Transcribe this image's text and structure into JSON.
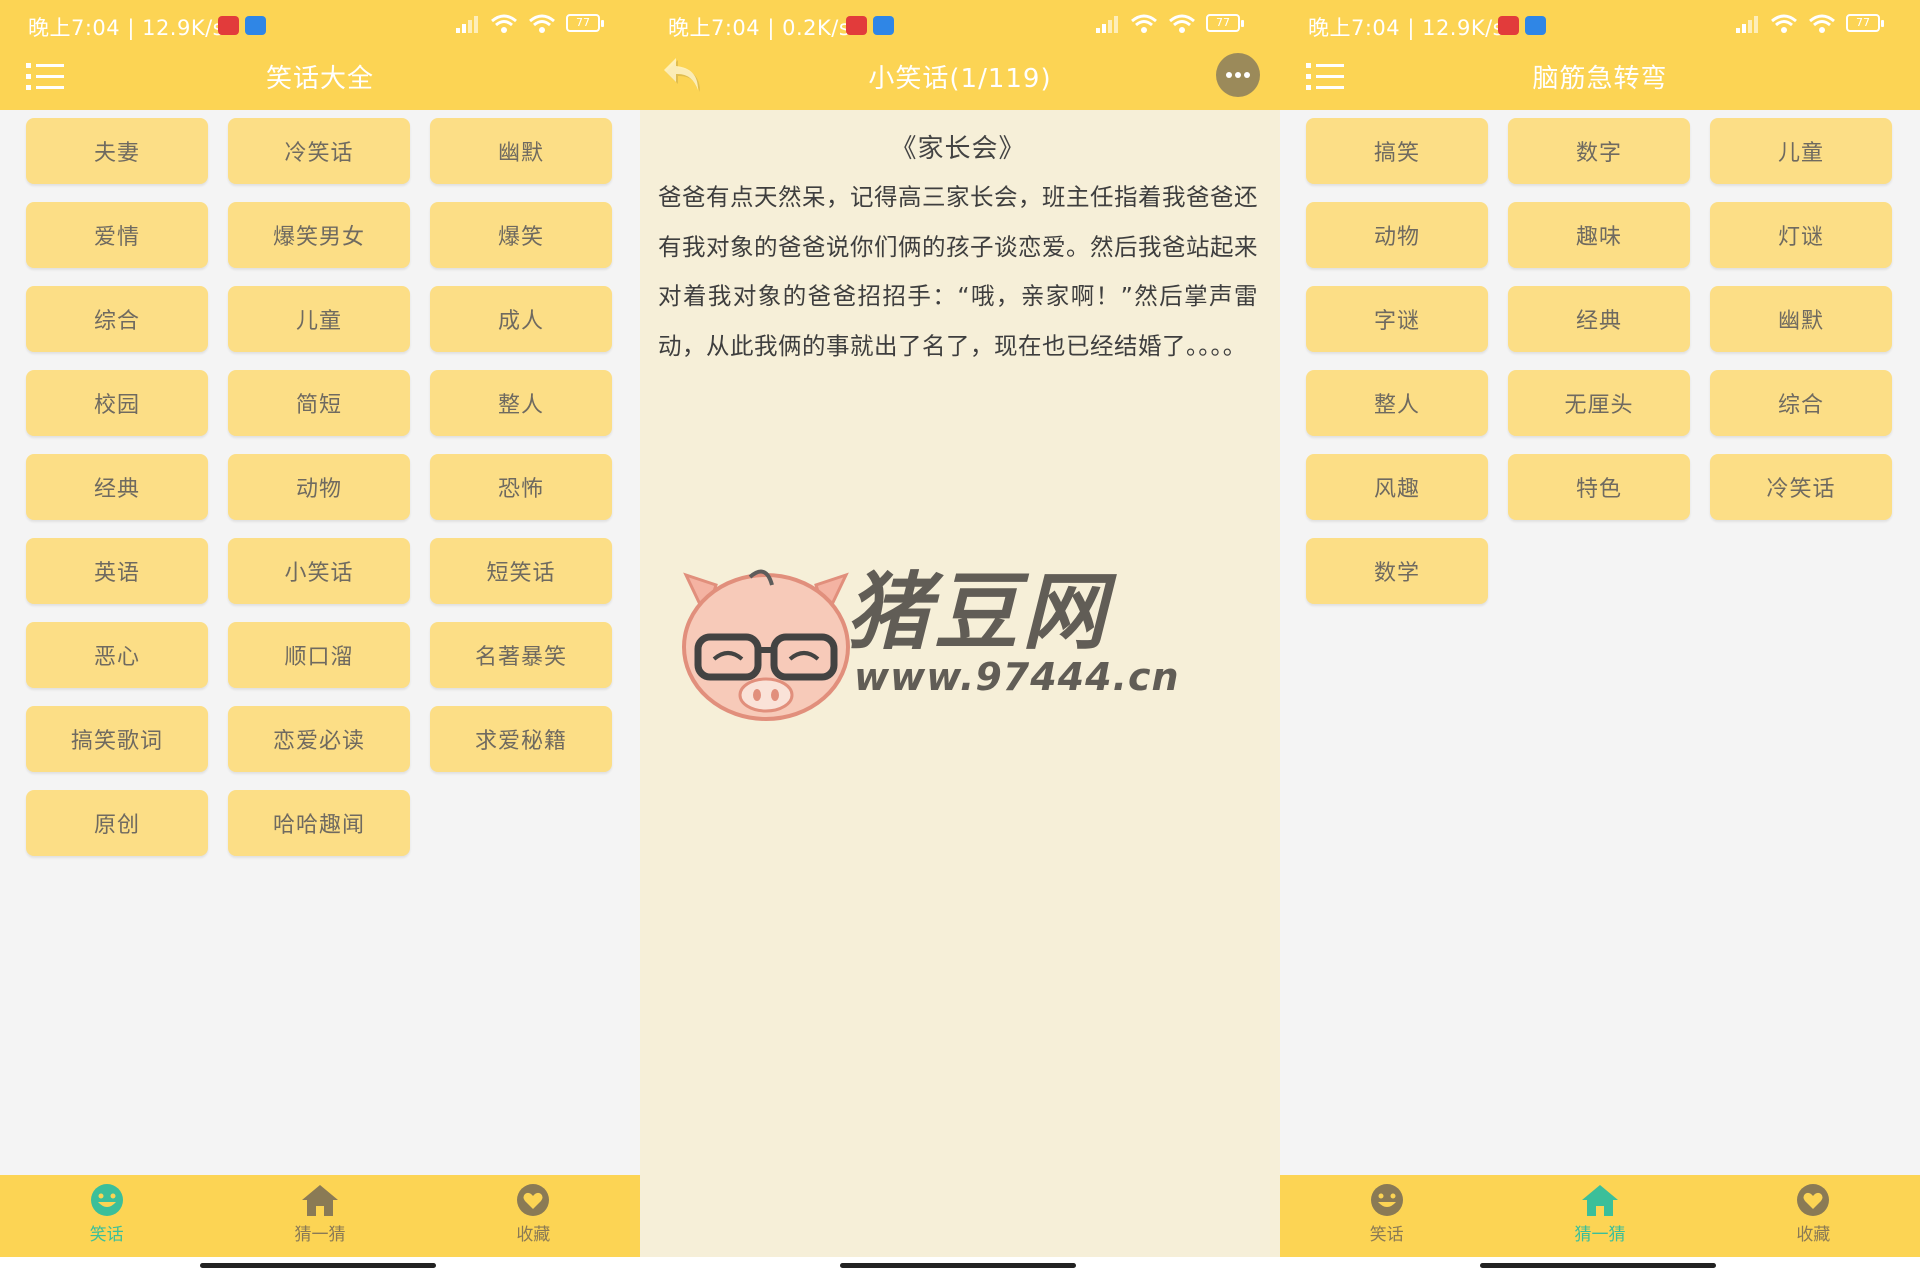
{
  "status": {
    "panel1": "晚上7:04 | 12.9K/s",
    "panel2": "晚上7:04 | 0.2K/s",
    "panel3": "晚上7:04 | 12.9K/s",
    "battery": "77"
  },
  "panel1": {
    "title": "笑话大全",
    "categories": [
      "夫妻",
      "冷笑话",
      "幽默",
      "爱情",
      "爆笑男女",
      "爆笑",
      "综合",
      "儿童",
      "成人",
      "校园",
      "简短",
      "整人",
      "经典",
      "动物",
      "恐怖",
      "英语",
      "小笑话",
      "短笑话",
      "恶心",
      "顺口溜",
      "名著暴笑",
      "搞笑歌词",
      "恋爱必读",
      "求爱秘籍",
      "原创",
      "哈哈趣闻"
    ]
  },
  "panel2": {
    "title": "小笑话(1/119)",
    "joke_title": "《家长会》",
    "joke_body": "爸爸有点天然呆，记得高三家长会，班主任指着我爸爸还有我对象的爸爸说你们俩的孩子谈恋爱。然后我爸站起来对着我对象的爸爸招招手：“哦，亲家啊！”然后掌声雷动，从此我俩的事就出了名了，现在也已经结婚了。。。。",
    "watermark_text": "猪豆网",
    "watermark_url": "www.97444.cn"
  },
  "panel3": {
    "title": "脑筋急转弯",
    "categories": [
      "搞笑",
      "数字",
      "儿童",
      "动物",
      "趣味",
      "灯谜",
      "字谜",
      "经典",
      "幽默",
      "整人",
      "无厘头",
      "综合",
      "风趣",
      "特色",
      "冷笑话",
      "数学"
    ]
  },
  "nav": {
    "jokes": "笑话",
    "guess": "猜一猜",
    "favorites": "收藏",
    "active_color": "#3bbf9a",
    "inactive_color": "#8a7a55"
  },
  "colors": {
    "header": "#fcd454",
    "button": "#fcde86",
    "reader_bg": "#f6efd8"
  },
  "icons": {
    "menu": "menu-icon",
    "back": "back-arrow-icon",
    "more": "more-dots-icon",
    "jokes": "smiley-face-icon",
    "guess": "home-icon",
    "favorites": "heart-icon"
  }
}
